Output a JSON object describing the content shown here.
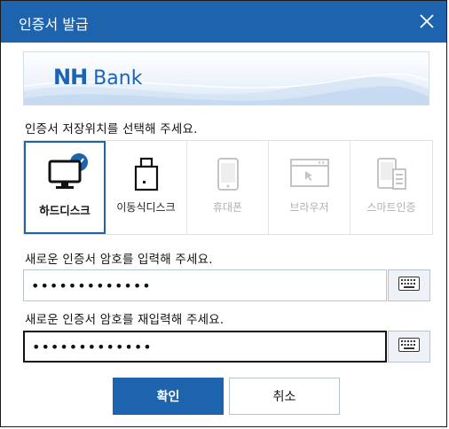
{
  "dialog": {
    "title": "인증서 발급",
    "close_icon": "close-icon"
  },
  "banner": {
    "logo_nh": "NH",
    "logo_bank": "Bank"
  },
  "location": {
    "prompt": "인증서 저장위치를 선택해 주세요.",
    "options": [
      {
        "label": "하드디스크",
        "icon": "monitor-icon",
        "state": "selected"
      },
      {
        "label": "이동식디스크",
        "icon": "usb-drive-icon",
        "state": "enabled"
      },
      {
        "label": "휴대폰",
        "icon": "phone-icon",
        "state": "disabled"
      },
      {
        "label": "브라우저",
        "icon": "browser-icon",
        "state": "disabled"
      },
      {
        "label": "스마트인증",
        "icon": "smart-auth-icon",
        "state": "disabled"
      }
    ],
    "selected_icon": "checkmark-icon"
  },
  "password": {
    "prompt": "새로운 인증서 암호를 입력해 주세요.",
    "value": "•••••••••••••",
    "keyboard_icon": "keyboard-icon"
  },
  "password_confirm": {
    "prompt": "새로운 인증서 암호를 재입력해 주세요.",
    "value": "•••••••••••••",
    "keyboard_icon": "keyboard-icon"
  },
  "actions": {
    "confirm_label": "확인",
    "cancel_label": "취소"
  },
  "colors": {
    "accent": "#1e63ad",
    "disabled_text": "#b0b0b0"
  }
}
